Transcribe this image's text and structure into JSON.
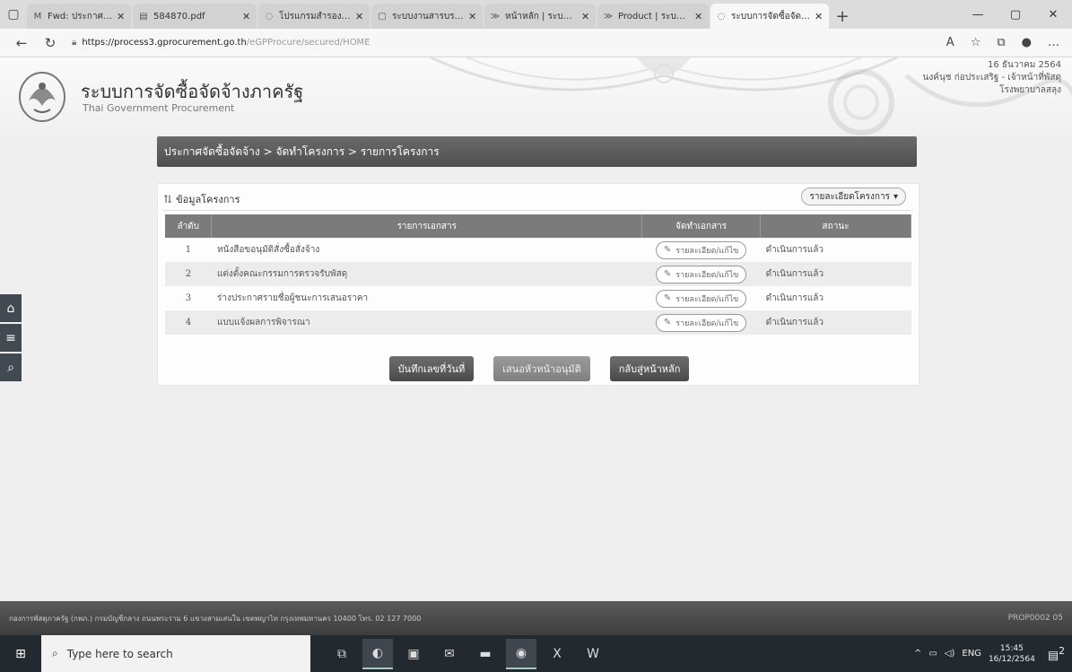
{
  "browser": {
    "tabs": [
      {
        "icon": "gmail-icon",
        "title": "Fwd: ประกาศผลผู้ชนะ",
        "active": false
      },
      {
        "icon": "pdf-icon",
        "title": "584870.pdf",
        "active": false
      },
      {
        "icon": "page-icon",
        "title": "โปรแกรมสำรองข้อมูล",
        "active": false
      },
      {
        "icon": "page-icon",
        "title": "ระบบงานสารบรรณ",
        "active": false
      },
      {
        "icon": "page-icon",
        "title": "หน้าหลัก | ระบบแผนเงิน",
        "active": false
      },
      {
        "icon": "page-icon",
        "title": "Product | ระบบแผนเงิน",
        "active": false
      },
      {
        "icon": "page-icon",
        "title": "ระบบการจัดซื้อจัดจ้าง",
        "active": true
      }
    ],
    "url_host": "https://process3.gprocurement.go.th",
    "url_path": "/eGPProcure/secured/HOME"
  },
  "header": {
    "title": "ระบบการจัดซื้อจัดจ้างภาครัฐ",
    "subtitle": "Thai Government Procurement",
    "date": "16 ธันวาคม 2564",
    "user": "นงค์นุช ก่อประเสริฐ - เจ้าหน้าที่พัสดุ",
    "org": "โรงพยาบาลสลุง"
  },
  "breadcrumb": "ประกาศจัดซื้อจัดจ้าง > จัดทำโครงการ > รายการโครงการ",
  "panel": {
    "heading": "ข้อมูลโครงการ",
    "detail_dropdown": "รายละเอียดโครงการ"
  },
  "table": {
    "headers": {
      "no": "ลำดับ",
      "doc": "รายการเอกสาร",
      "action": "จัดทำเอกสาร",
      "status": "สถานะ"
    },
    "rows": [
      {
        "no": "1",
        "doc": "หนังสือขอนุมัติสั่งซื้อสั่งจ้าง",
        "action": "รายละเอียด/แก้ไข",
        "status": "ดำเนินการแล้ว"
      },
      {
        "no": "2",
        "doc": "แต่งตั้งคณะกรรมการตรวจรับพัสดุ",
        "action": "รายละเอียด/แก้ไข",
        "status": "ดำเนินการแล้ว"
      },
      {
        "no": "3",
        "doc": "ร่างประกาศรายชื่อผู้ชนะการเสนอราคา",
        "action": "รายละเอียด/แก้ไข",
        "status": "ดำเนินการแล้ว"
      },
      {
        "no": "4",
        "doc": "แบบแจ้งผลการพิจารณา",
        "action": "รายละเอียด/แก้ไข",
        "status": "ดำเนินการแล้ว"
      }
    ]
  },
  "buttons": {
    "save_number_date": "บันทึกเลขที่วันที่",
    "submit_approval": "เสนอหัวหน้าอนุมัติ",
    "back_home": "กลับสู่หน้าหลัก"
  },
  "footer": {
    "address": "กองการพัสดุภาครัฐ (กพภ.) กรมบัญชีกลาง ถนนพระราม 6 แขวงสามเสนใน เขตพญาไท กรุงเทพมหานคร 10400 โทร. 02 127 7000",
    "code": "PROP0002 05"
  },
  "taskbar": {
    "search_placeholder": "Type here to search",
    "lang": "ENG",
    "time": "15:45",
    "date": "16/12/2564",
    "notif_count": "2"
  }
}
